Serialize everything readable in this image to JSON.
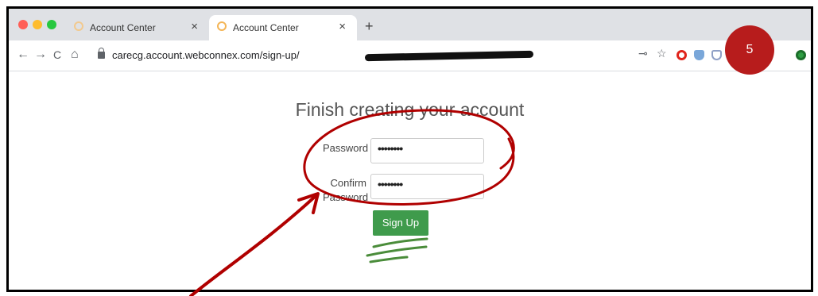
{
  "browser": {
    "tabs": [
      {
        "title": "Account Center",
        "active": false
      },
      {
        "title": "Account Center",
        "active": true
      }
    ],
    "tab_close_glyph": "×",
    "new_tab_glyph": "+",
    "nav": {
      "back": "←",
      "forward": "→",
      "reload": "C",
      "home": "⌂"
    },
    "url": "carecg.account.webconnex.com/sign-up/",
    "toolbar_icons": [
      "key-icon",
      "star-icon",
      "opera-icon",
      "shield-icon",
      "shield-icon",
      "circle-icon",
      "circle-icon",
      "green-extension-icon"
    ],
    "key_glyph": "⊸",
    "star_glyph": "☆"
  },
  "badge": {
    "number": "5",
    "color": "#b71c1c"
  },
  "form": {
    "heading": "Finish creating your account",
    "password_label": "Password",
    "password_value": "••••••••",
    "confirm_label_line1": "Confirm",
    "confirm_label_line2": "Password",
    "confirm_value": "••••••••",
    "submit_label": "Sign Up",
    "submit_color": "#3f9b4c"
  },
  "annotations": {
    "circle_color": "#b00000",
    "underline_color": "#4a8c3a"
  }
}
